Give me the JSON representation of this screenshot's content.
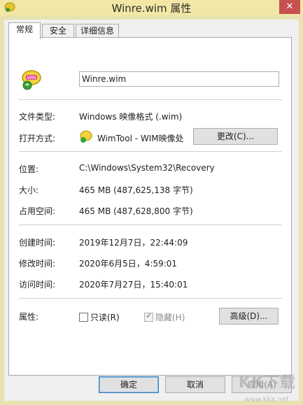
{
  "window": {
    "title": "Winre.wim 属性",
    "close_glyph": "✕"
  },
  "tabs": [
    {
      "label": "常规"
    },
    {
      "label": "安全"
    },
    {
      "label": "详细信息"
    }
  ],
  "general": {
    "file_name": "Winre.wim",
    "rows": {
      "file_type": {
        "label": "文件类型:",
        "value": "Windows 映像格式 (.wim)"
      },
      "opens_with": {
        "label": "打开方式:",
        "value": "WimTool - WIM映像处",
        "button": "更改(C)..."
      },
      "location": {
        "label": "位置:",
        "value": "C:\\Windows\\System32\\Recovery"
      },
      "size": {
        "label": "大小:",
        "value": "465 MB (487,625,138 字节)"
      },
      "size_on_disk": {
        "label": "占用空间:",
        "value": "465 MB (487,628,800 字节)"
      },
      "created": {
        "label": "创建时间:",
        "value": "2019年12月7日，22:44:09"
      },
      "modified": {
        "label": "修改时间:",
        "value": "2020年6月5日，4:59:01"
      },
      "accessed": {
        "label": "访问时间:",
        "value": "2020年7月27日，15:40:01"
      }
    },
    "attributes": {
      "label": "属性:",
      "readonly": {
        "label": "只读(R)",
        "checked": false
      },
      "hidden": {
        "label": "隐藏(H)",
        "checked": true,
        "disabled": true
      },
      "advanced_button": "高级(D)..."
    }
  },
  "footer": {
    "ok": "确定",
    "cancel": "取消",
    "apply": "应用(A)"
  },
  "watermark": {
    "text": "KK下载",
    "url": "www.kkx.net"
  },
  "icons": {
    "file_icon": "wim-file-icon",
    "app_icon": "wimtool-app-icon"
  }
}
